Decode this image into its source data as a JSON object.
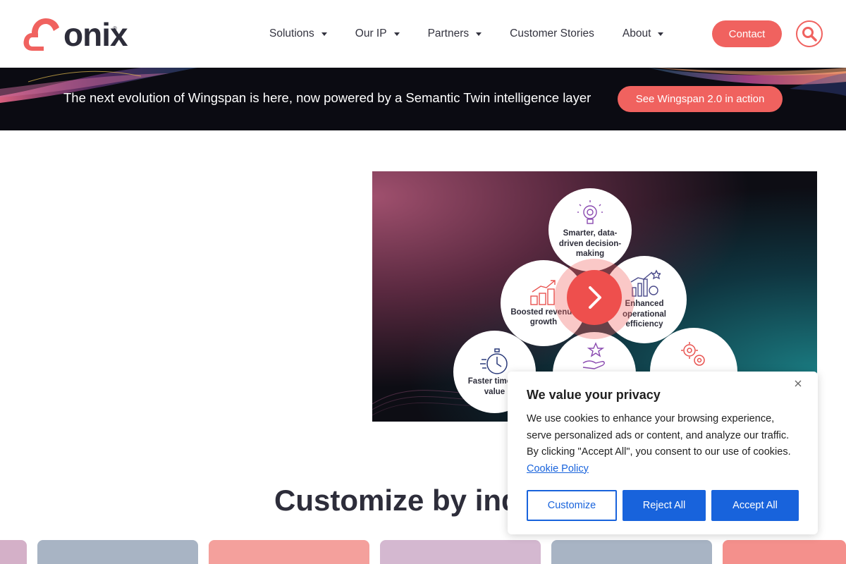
{
  "header": {
    "logo_text": "onix",
    "logo_mark": "®",
    "nav": [
      {
        "label": "Solutions",
        "has_dropdown": true
      },
      {
        "label": "Our IP",
        "has_dropdown": true
      },
      {
        "label": "Partners",
        "has_dropdown": true
      },
      {
        "label": "Customer Stories",
        "has_dropdown": false
      },
      {
        "label": "About",
        "has_dropdown": true
      }
    ],
    "contact_label": "Contact",
    "search_icon": "search-icon"
  },
  "banner": {
    "text": "The next evolution of Wingspan is here, now powered by a Semantic Twin intelligence layer",
    "button_label": "See Wingspan 2.0 in action"
  },
  "video": {
    "circles": [
      {
        "label": "Smarter, data-driven decision-making",
        "icon": "lightbulb-icon"
      },
      {
        "label": "Boosted revenue growth",
        "icon": "coins-growth-icon"
      },
      {
        "label": "Enhanced operational efficiency",
        "icon": "chart-gear-icon"
      },
      {
        "label": "Faster time to value",
        "icon": "stopwatch-icon"
      },
      {
        "label": "",
        "icon": "hand-star-icon"
      },
      {
        "label": "",
        "icon": "gears-icon"
      }
    ],
    "play_icon": "play-icon"
  },
  "section": {
    "heading": "Customize by indu"
  },
  "cookie": {
    "title": "We value your privacy",
    "body": "We use cookies to enhance your browsing experience, serve personalized ads or content, and analyze our traffic. By clicking \"Accept All\", you consent to our use of cookies.",
    "policy_link": "Cookie Policy",
    "customize_label": "Customize",
    "reject_label": "Reject All",
    "accept_label": "Accept All",
    "close_icon": "close-icon"
  },
  "colors": {
    "accent": "#f0625f",
    "cookie_blue": "#1863dc",
    "text_dark": "#2d2d3a",
    "card_colors": [
      "#d4b0c8",
      "#a8b4c4",
      "#f4a09c",
      "#d4b8d0",
      "#a8b4c4",
      "#f4908c"
    ]
  }
}
